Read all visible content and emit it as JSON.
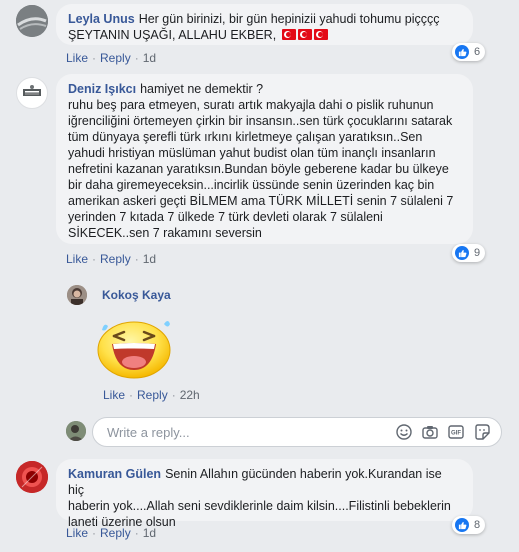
{
  "comments": [
    {
      "author": "Leyla Unus",
      "text_lines": [
        "Her gün birinizi, bir gün hepinizii yahudi tohumu piçççç",
        "ŞEYTANIN UŞAĞI, ALLAHU EKBER,"
      ],
      "like_label": "Like",
      "reply_label": "Reply",
      "time": "1d",
      "reaction_count": "6"
    },
    {
      "author": "Deniz Işıkcı",
      "text_lines": [
        "hamiyet ne demektir ?",
        "ruhu beş para etmeyen, suratı artık makyajla dahi o pislik ruhunun",
        "iğrenciliğini örtemeyen çirkin bir insansın..sen türk çocuklarını satarak",
        "tüm dünyaya şerefli türk ırkını kirletmeye çalışan yaratıksın..Sen",
        "yahudi hristiyan müslüman yahut budist olan tüm inançlı insanların",
        "nefretini kazanan yaratıksın.Bundan böyle geberene kadar bu ülkeye",
        "bir daha giremeyeceksin...incirlik üssünde senin üzerinden kaç bin",
        "amerikan askeri geçti BİLMEM ama TÜRK MİLLETİ senin 7 sülaleni 7",
        "yerinden 7 kıtada 7 ülkede 7 türk devleti olarak 7 sülaleni",
        "SİKECEK..sen 7 rakamını seversin"
      ],
      "like_label": "Like",
      "reply_label": "Reply",
      "time": "1d",
      "reaction_count": "9"
    },
    {
      "author": "Kokoş Kaya",
      "like_label": "Like",
      "reply_label": "Reply",
      "time": "22h"
    },
    {
      "author": "Kamuran Gülen",
      "text_lines": [
        "Senin Allahın gücünden haberin yok.Kurandan ise hiç",
        "haberin yok....Allah seni sevdiklerinle daim kilsin....Filistinli bebeklerin",
        "laneti üzerine olsun"
      ],
      "like_label": "Like",
      "reply_label": "Reply",
      "time": "1d",
      "reaction_count": "8"
    }
  ],
  "reply_input": {
    "placeholder": "Write a reply..."
  },
  "icons": {
    "reaction": "like-icon",
    "composer": [
      "emoji-icon",
      "camera-icon",
      "gif-icon",
      "sticker-icon"
    ],
    "sticker": "laughing-emoji-sticker",
    "flags": "turkish-flag-icon"
  },
  "colors": {
    "background": "#e9ebee",
    "bubble": "#f2f3f5",
    "author": "#385898",
    "like_blue": "#1877f2",
    "meta": "#606770"
  }
}
